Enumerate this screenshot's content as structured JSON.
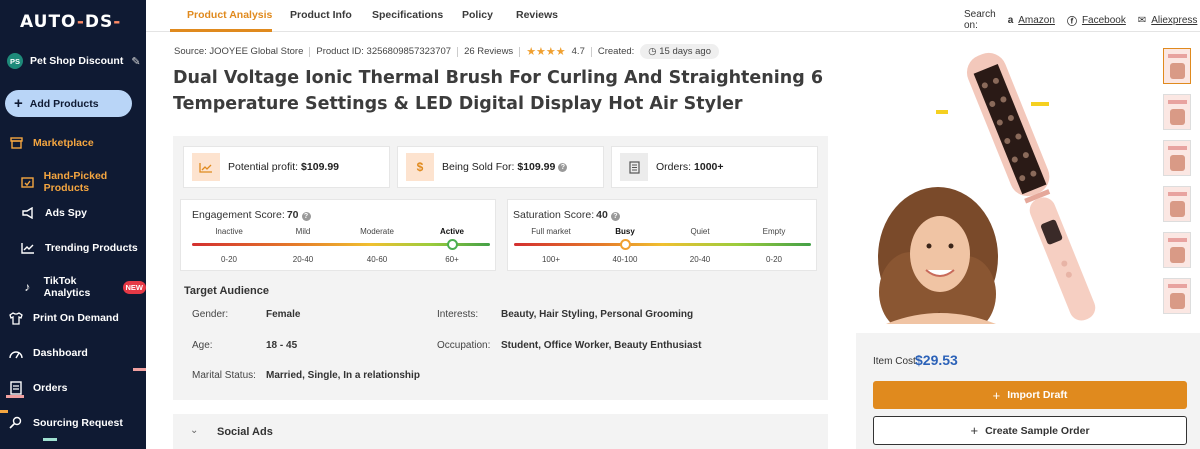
{
  "brand": {
    "logo_left": "AUT",
    "logo_mid": "O",
    "logo_dash": "-",
    "logo_right": "DS",
    "logo_dash2": "-"
  },
  "store": {
    "initials": "PS",
    "name": "Pet Shop Discount"
  },
  "sidebar": {
    "add_products": "Add Products",
    "items": [
      {
        "label": "Marketplace",
        "icon": "store-icon"
      },
      {
        "label": "Hand-Picked Products",
        "icon": "hand-picked-icon"
      },
      {
        "label": "Ads Spy",
        "icon": "megaphone-icon"
      },
      {
        "label": "Trending Products",
        "icon": "trend-chart-icon"
      },
      {
        "label": "TikTok Analytics",
        "icon": "tiktok-icon",
        "badge": "NEW"
      },
      {
        "label": "Print On Demand",
        "icon": "shirt-icon"
      },
      {
        "label": "Dashboard",
        "icon": "gauge-icon"
      },
      {
        "label": "Orders",
        "icon": "receipt-icon"
      },
      {
        "label": "Sourcing Request",
        "icon": "sourcing-icon"
      }
    ]
  },
  "tabs": [
    "Product Analysis",
    "Product Info",
    "Specifications",
    "Policy",
    "Reviews"
  ],
  "search_on": {
    "label": "Search on:",
    "links": [
      "Amazon",
      "Facebook",
      "Aliexpress"
    ]
  },
  "meta": {
    "source": "Source: JOOYEE Global Store",
    "product_id": "Product ID: 3256809857323707",
    "reviews": "26 Reviews",
    "stars": "★★★★",
    "rating": "4.7",
    "created_label": "Created:",
    "created_value": "15 days ago"
  },
  "title": "Dual Voltage Ionic Thermal Brush For Curling And Straightening 6 Temperature Settings & LED Digital Display Hot Air Styler",
  "stats": {
    "profit_label": "Potential profit:",
    "profit_value": "$109.99",
    "sold_label": "Being Sold For:",
    "sold_value": "$109.99",
    "orders_label": "Orders:",
    "orders_value": "1000+"
  },
  "engagement": {
    "label": "Engagement Score:",
    "score": "70",
    "levels": [
      "Inactive",
      "Mild",
      "Moderate",
      "Active"
    ],
    "ranges": [
      "0-20",
      "20-40",
      "40-60",
      "60+"
    ],
    "active_level": "Active"
  },
  "saturation": {
    "label": "Saturation Score:",
    "score": "40",
    "levels": [
      "Full market",
      "Busy",
      "Quiet",
      "Empty"
    ],
    "ranges": [
      "100+",
      "40-100",
      "20-40",
      "0-20"
    ],
    "active_level": "Busy"
  },
  "target_audience": {
    "title": "Target Audience",
    "gender_label": "Gender:",
    "gender": "Female",
    "age_label": "Age:",
    "age": "18 - 45",
    "marital_label": "Marital Status:",
    "marital": "Married, Single, In a relationship",
    "interests_label": "Interests:",
    "interests": "Beauty, Hair Styling, Personal Grooming",
    "occupation_label": "Occupation:",
    "occupation": "Student, Office Worker, Beauty Enthusiast"
  },
  "social_ads": "Social Ads",
  "cost": {
    "label": "Item Cost",
    "value": "$29.53"
  },
  "buttons": {
    "import": "Import Draft",
    "sample": "Create Sample Order"
  },
  "colors": {
    "accent": "#e08a1e",
    "sidebar": "#0f1a33",
    "price": "#2c62b8"
  }
}
